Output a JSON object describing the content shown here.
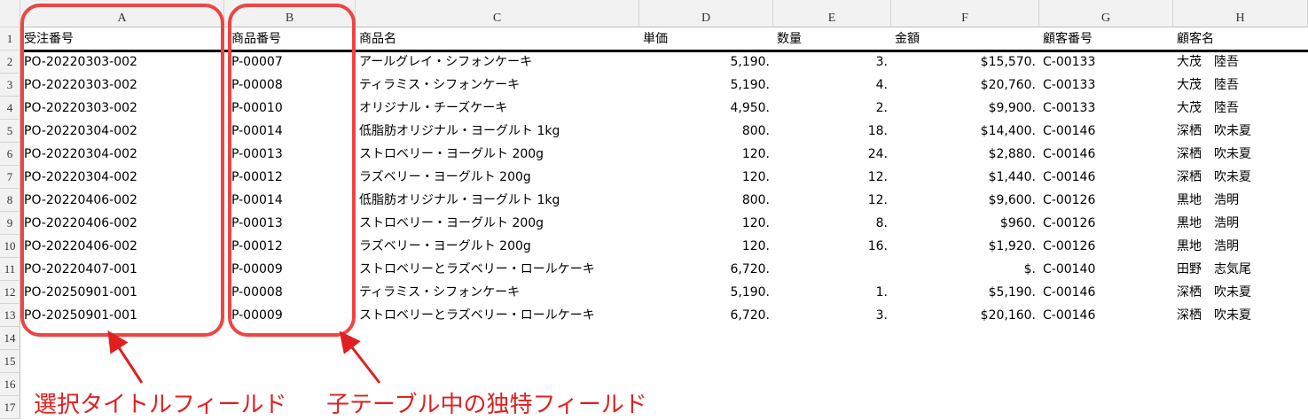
{
  "columns": [
    "A",
    "B",
    "C",
    "D",
    "E",
    "F",
    "G",
    "H"
  ],
  "row_numbers": [
    "1",
    "2",
    "3",
    "4",
    "5",
    "6",
    "7",
    "8",
    "9",
    "10",
    "11",
    "12",
    "13",
    "14",
    "15",
    "16",
    "17"
  ],
  "header": {
    "order_id": "受注番号",
    "product_id": "商品番号",
    "product_name": "商品名",
    "unit_price": "単価",
    "quantity": "数量",
    "amount": "金額",
    "customer_id": "顧客番号",
    "customer_name": "顧客名"
  },
  "rows": [
    {
      "order_id": "PO-20220303-002",
      "product_id": "P-00007",
      "product_name": "アールグレイ・シフォンケーキ",
      "unit_price": "5,190.",
      "quantity": "3.",
      "amount": "$15,570.",
      "customer_id": "C-00133",
      "customer_name": "大茂　陸吾"
    },
    {
      "order_id": "PO-20220303-002",
      "product_id": "P-00008",
      "product_name": "ティラミス・シフォンケーキ",
      "unit_price": "5,190.",
      "quantity": "4.",
      "amount": "$20,760.",
      "customer_id": "C-00133",
      "customer_name": "大茂　陸吾"
    },
    {
      "order_id": "PO-20220303-002",
      "product_id": "P-00010",
      "product_name": "オリジナル・チーズケーキ",
      "unit_price": "4,950.",
      "quantity": "2.",
      "amount": "$9,900.",
      "customer_id": "C-00133",
      "customer_name": "大茂　陸吾"
    },
    {
      "order_id": "PO-20220304-002",
      "product_id": "P-00014",
      "product_name": "低脂肪オリジナル・ヨーグルト 1kg",
      "unit_price": "800.",
      "quantity": "18.",
      "amount": "$14,400.",
      "customer_id": "C-00146",
      "customer_name": "深栖　吹未夏"
    },
    {
      "order_id": "PO-20220304-002",
      "product_id": "P-00013",
      "product_name": "ストロベリー・ヨーグルト 200g",
      "unit_price": "120.",
      "quantity": "24.",
      "amount": "$2,880.",
      "customer_id": "C-00146",
      "customer_name": "深栖　吹未夏"
    },
    {
      "order_id": "PO-20220304-002",
      "product_id": "P-00012",
      "product_name": "ラズベリー・ヨーグルト 200g",
      "unit_price": "120.",
      "quantity": "12.",
      "amount": "$1,440.",
      "customer_id": "C-00146",
      "customer_name": "深栖　吹未夏"
    },
    {
      "order_id": "PO-20220406-002",
      "product_id": "P-00014",
      "product_name": "低脂肪オリジナル・ヨーグルト 1kg",
      "unit_price": "800.",
      "quantity": "12.",
      "amount": "$9,600.",
      "customer_id": "C-00126",
      "customer_name": "黒地　浩明"
    },
    {
      "order_id": "PO-20220406-002",
      "product_id": "P-00013",
      "product_name": "ストロベリー・ヨーグルト 200g",
      "unit_price": "120.",
      "quantity": "8.",
      "amount": "$960.",
      "customer_id": "C-00126",
      "customer_name": "黒地　浩明"
    },
    {
      "order_id": "PO-20220406-002",
      "product_id": "P-00012",
      "product_name": "ラズベリー・ヨーグルト 200g",
      "unit_price": "120.",
      "quantity": "16.",
      "amount": "$1,920.",
      "customer_id": "C-00126",
      "customer_name": "黒地　浩明"
    },
    {
      "order_id": "PO-20220407-001",
      "product_id": "P-00009",
      "product_name": "ストロベリーとラズベリー・ロールケーキ",
      "unit_price": "6,720.",
      "quantity": "",
      "amount": "$.",
      "customer_id": "C-00140",
      "customer_name": "田野　志気尾"
    },
    {
      "order_id": "PO-20250901-001",
      "product_id": "P-00008",
      "product_name": "ティラミス・シフォンケーキ",
      "unit_price": "5,190.",
      "quantity": "1.",
      "amount": "$5,190.",
      "customer_id": "C-00146",
      "customer_name": "深栖　吹未夏"
    },
    {
      "order_id": "PO-20250901-001",
      "product_id": "P-00009",
      "product_name": "ストロベリーとラズベリー・ロールケーキ",
      "unit_price": "6,720.",
      "quantity": "3.",
      "amount": "$20,160.",
      "customer_id": "C-00146",
      "customer_name": "深栖　吹未夏"
    }
  ],
  "annotations": {
    "left": "選択タイトルフィールド",
    "right": "子テーブル中の独特フィールド",
    "color": "#ef4444"
  }
}
